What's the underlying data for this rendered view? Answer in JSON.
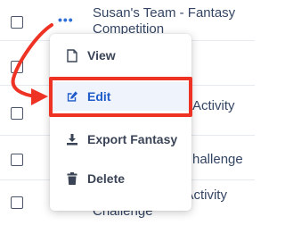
{
  "rows": [
    {
      "title_line1": "Susan's Team - Fantasy",
      "title_line2": "Competition",
      "dots": "•••"
    },
    {
      "title_line1": ""
    },
    {
      "title_line1": "Activity"
    },
    {
      "title_line1": "hallenge"
    },
    {
      "title_line1": "Jason's Team - Activity",
      "title_line2": "Challenge",
      "dots": "•••"
    }
  ],
  "menu": {
    "items": [
      {
        "label": "View",
        "icon": "document-icon"
      },
      {
        "label": "Edit",
        "icon": "edit-icon",
        "active": true
      },
      {
        "label": "Export Fantasy",
        "icon": "download-icon"
      },
      {
        "label": "Delete",
        "icon": "trash-icon"
      }
    ]
  },
  "annotation": {
    "color": "#ee3224"
  }
}
